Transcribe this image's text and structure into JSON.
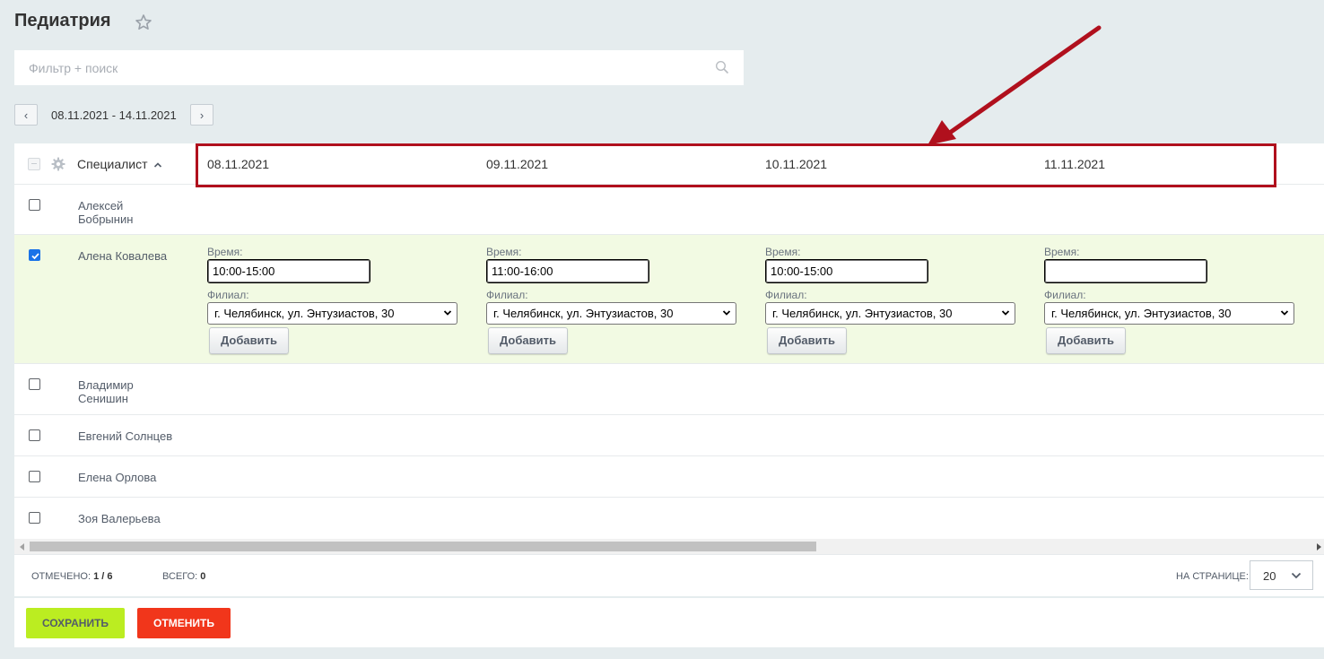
{
  "page": {
    "title": "Педиатрия"
  },
  "search": {
    "placeholder": "Фильтр + поиск"
  },
  "period": {
    "range": "08.11.2021 - 14.11.2021",
    "prev": "‹",
    "next": "›"
  },
  "grid": {
    "specialist_header": "Специалист",
    "dates": [
      "08.11.2021",
      "09.11.2021",
      "10.11.2021",
      "11.11.2021"
    ],
    "rows": [
      {
        "name": "Алексей Бобрынин",
        "checked": false
      },
      {
        "name": "Алена Ковалева",
        "checked": true
      },
      {
        "name": "Владимир Сенишин",
        "checked": false
      },
      {
        "name": "Евгений Солнцев",
        "checked": false
      },
      {
        "name": "Елена Орлова",
        "checked": false
      },
      {
        "name": "Зоя Валерьева",
        "checked": false
      }
    ],
    "editor": {
      "time_label": "Время:",
      "branch_label": "Филиал:",
      "add_label": "Добавить",
      "cells": [
        {
          "time": "10:00-15:00",
          "branch": "г. Челябинск, ул. Энтузиастов, 30"
        },
        {
          "time": "11:00-16:00",
          "branch": "г. Челябинск, ул. Энтузиастов, 30"
        },
        {
          "time": "10:00-15:00",
          "branch": "г. Челябинск, ул. Энтузиастов, 30"
        },
        {
          "time": "",
          "branch": "г. Челябинск, ул. Энтузиастов, 30"
        }
      ]
    }
  },
  "footer": {
    "marked_label": "Отмечено:",
    "marked_value": "1 / 6",
    "total_label": "Всего:",
    "total_value": "0",
    "per_page_label": "На странице:",
    "per_page_value": "20"
  },
  "actions": {
    "save": "Сохранить",
    "cancel": "Отменить"
  },
  "colors": {
    "highlight": "#b0101d",
    "save": "#bbed21",
    "cancel": "#f1361b",
    "selected_row": "#f2fae3"
  }
}
